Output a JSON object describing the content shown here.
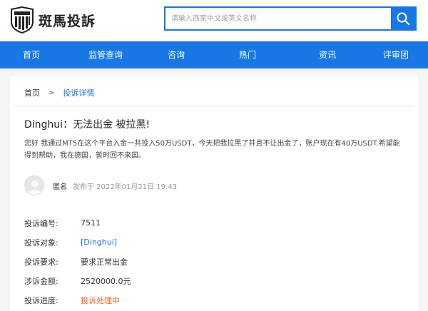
{
  "header": {
    "logo_text": "斑馬投訴",
    "search_placeholder": "请输入商家中文或英文名称"
  },
  "nav": [
    "首页",
    "监管查询",
    "咨询",
    "热门",
    "资讯",
    "评审团"
  ],
  "breadcrumb": {
    "home": "首页",
    "sep": ">",
    "current": "投诉详情"
  },
  "complaint": {
    "title": "Dinghui：无法出金 被拉黑!",
    "description": "您好 我通过MT5在这个平台入金一共投入50万USDT，今天把我拉黑了并且不让出金了，账户现在有40万USDT.希望能得到帮助，我在德国，暂时回不来国。",
    "author": "匿名",
    "date": "发布于 2022年01月21日 19:43"
  },
  "info": [
    {
      "label": "投诉编号:",
      "value": "7511"
    },
    {
      "label": "投诉对象:",
      "value": "[Dinghui]"
    },
    {
      "label": "投诉要求:",
      "value": "要求正常出金"
    },
    {
      "label": "涉诉金额:",
      "value": "2520000.0元"
    },
    {
      "label": "投诉进度:",
      "value": "投诉处理中"
    }
  ],
  "colors": {
    "accent": "#1677e5",
    "status": "#f26522"
  }
}
